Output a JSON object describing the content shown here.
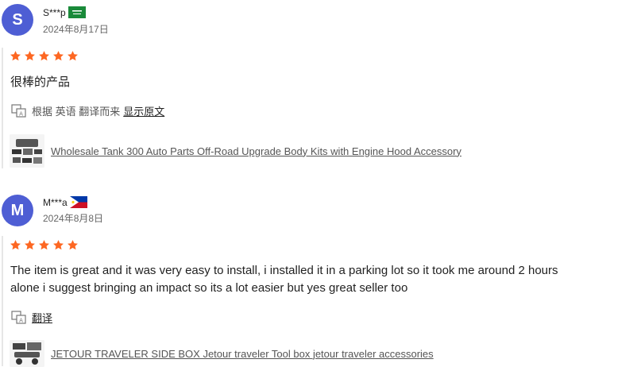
{
  "reviews": [
    {
      "avatar_letter": "S",
      "username": "S***p",
      "flag": "saudi-arabia-flag",
      "date": "2024年8月17日",
      "rating": 5,
      "text_lines": [
        "很棒的产品"
      ],
      "translation": {
        "prefix": "根据 英语 翻译而来",
        "link": "显示原文"
      },
      "product": {
        "title": "Wholesale Tank 300 Auto Parts Off-Road Upgrade Body Kits with Engine Hood Accessory"
      }
    },
    {
      "avatar_letter": "M",
      "username": "M***a",
      "flag": "philippines-flag",
      "date": "2024年8月8日",
      "rating": 5,
      "text_lines": [
        "The item is great and it was very easy to install, i installed it in a parking lot so it took me around 2 hours",
        "alone i suggest bringing an impact so its a lot easier but yes great seller too"
      ],
      "translation": {
        "link": "翻译"
      },
      "product": {
        "title": "JETOUR TRAVELER SIDE BOX Jetour traveler Tool box jetour traveler accessories"
      }
    }
  ],
  "colors": {
    "avatar": "#4e5ed4",
    "star": "#fd6722",
    "text": "#222222",
    "muted": "#666666"
  }
}
